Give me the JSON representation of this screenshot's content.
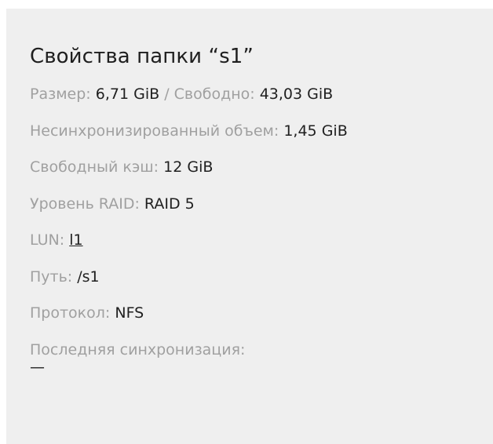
{
  "panel": {
    "title": "Свойства папки “s1”"
  },
  "props": {
    "size_label": "Размер:",
    "size_value": "6,71 GiB",
    "separator": "/",
    "free_label": "Свободно:",
    "free_value": "43,03 GiB",
    "unsynced_label": "Несинхронизированный объем:",
    "unsynced_value": "1,45 GiB",
    "cache_label": "Свободный кэш:",
    "cache_value": "12 GiB",
    "raid_label": "Уровень RAID:",
    "raid_value": "RAID 5",
    "lun_label": "LUN:",
    "lun_value": "l1",
    "path_label": "Путь:",
    "path_value": "/s1",
    "protocol_label": "Протокол:",
    "protocol_value": "NFS",
    "last_sync_label": "Последняя синхронизация:",
    "last_sync_value": "—"
  }
}
